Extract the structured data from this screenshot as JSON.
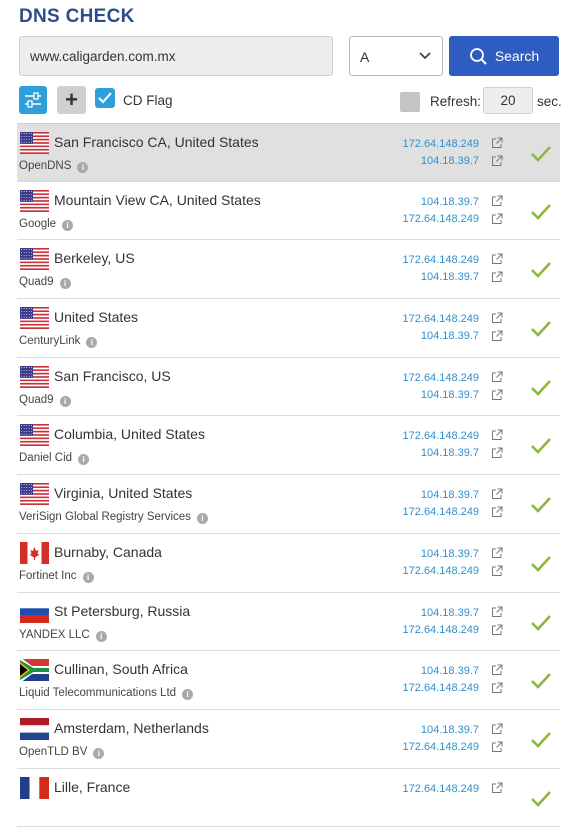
{
  "header": {
    "title": "DNS CHECK"
  },
  "search": {
    "domain": "www.caligarden.com.mx",
    "record_type": "A",
    "button_label": "Search"
  },
  "options": {
    "cd_flag_label": "CD Flag",
    "cd_flag_checked": true,
    "refresh_label": "Refresh:",
    "refresh_value": "20",
    "refresh_unit": "sec.",
    "refresh_checked": false
  },
  "results": [
    {
      "flag": "us",
      "location": "San Francisco CA, United States",
      "provider": "OpenDNS",
      "ips": [
        "172.64.148.249",
        "104.18.39.7"
      ]
    },
    {
      "flag": "us",
      "location": "Mountain View CA, United States",
      "provider": "Google",
      "ips": [
        "104.18.39.7",
        "172.64.148.249"
      ]
    },
    {
      "flag": "us",
      "location": "Berkeley, US",
      "provider": "Quad9",
      "ips": [
        "172.64.148.249",
        "104.18.39.7"
      ]
    },
    {
      "flag": "us",
      "location": "United States",
      "provider": "CenturyLink",
      "ips": [
        "172.64.148.249",
        "104.18.39.7"
      ]
    },
    {
      "flag": "us",
      "location": "San Francisco, US",
      "provider": "Quad9",
      "ips": [
        "172.64.148.249",
        "104.18.39.7"
      ]
    },
    {
      "flag": "us",
      "location": "Columbia, United States",
      "provider": "Daniel Cid",
      "ips": [
        "172.64.148.249",
        "104.18.39.7"
      ]
    },
    {
      "flag": "us",
      "location": "Virginia, United States",
      "provider": "VeriSign Global Registry Services",
      "ips": [
        "104.18.39.7",
        "172.64.148.249"
      ]
    },
    {
      "flag": "ca",
      "location": "Burnaby, Canada",
      "provider": "Fortinet Inc",
      "ips": [
        "104.18.39.7",
        "172.64.148.249"
      ]
    },
    {
      "flag": "ru",
      "location": "St Petersburg, Russia",
      "provider": "YANDEX LLC",
      "ips": [
        "104.18.39.7",
        "172.64.148.249"
      ]
    },
    {
      "flag": "za",
      "location": "Cullinan, South Africa",
      "provider": "Liquid Telecommunications Ltd",
      "ips": [
        "104.18.39.7",
        "172.64.148.249"
      ]
    },
    {
      "flag": "nl",
      "location": "Amsterdam, Netherlands",
      "provider": "OpenTLD BV",
      "ips": [
        "104.18.39.7",
        "172.64.148.249"
      ]
    },
    {
      "flag": "fr",
      "location": "Lille, France",
      "provider": "",
      "ips": [
        "172.64.148.249"
      ]
    }
  ],
  "colors": {
    "title": "#2d4e8c",
    "accent": "#2f9fdc",
    "search_button": "#2f5cc0",
    "ip_link": "#2f8fce",
    "check": "#8ab83c"
  }
}
